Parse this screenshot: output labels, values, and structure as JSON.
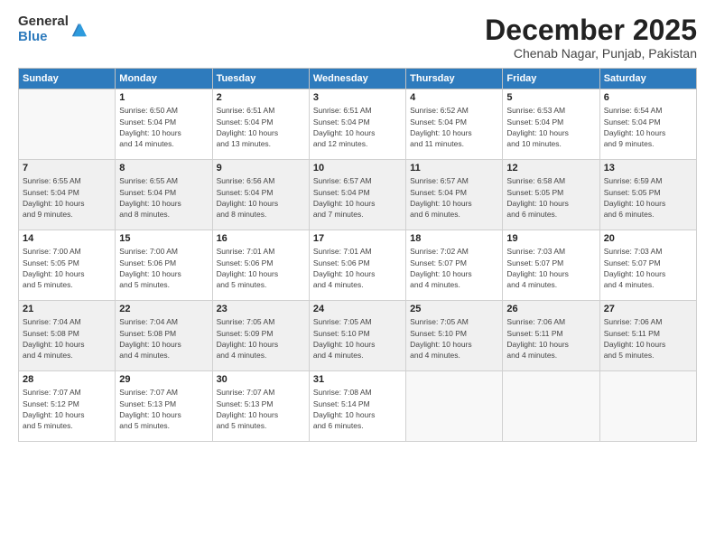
{
  "header": {
    "logo_general": "General",
    "logo_blue": "Blue",
    "month_title": "December 2025",
    "subtitle": "Chenab Nagar, Punjab, Pakistan"
  },
  "days_of_week": [
    "Sunday",
    "Monday",
    "Tuesday",
    "Wednesday",
    "Thursday",
    "Friday",
    "Saturday"
  ],
  "weeks": [
    [
      {
        "num": "",
        "info": ""
      },
      {
        "num": "1",
        "info": "Sunrise: 6:50 AM\nSunset: 5:04 PM\nDaylight: 10 hours\nand 14 minutes."
      },
      {
        "num": "2",
        "info": "Sunrise: 6:51 AM\nSunset: 5:04 PM\nDaylight: 10 hours\nand 13 minutes."
      },
      {
        "num": "3",
        "info": "Sunrise: 6:51 AM\nSunset: 5:04 PM\nDaylight: 10 hours\nand 12 minutes."
      },
      {
        "num": "4",
        "info": "Sunrise: 6:52 AM\nSunset: 5:04 PM\nDaylight: 10 hours\nand 11 minutes."
      },
      {
        "num": "5",
        "info": "Sunrise: 6:53 AM\nSunset: 5:04 PM\nDaylight: 10 hours\nand 10 minutes."
      },
      {
        "num": "6",
        "info": "Sunrise: 6:54 AM\nSunset: 5:04 PM\nDaylight: 10 hours\nand 9 minutes."
      }
    ],
    [
      {
        "num": "7",
        "info": "Sunrise: 6:55 AM\nSunset: 5:04 PM\nDaylight: 10 hours\nand 9 minutes."
      },
      {
        "num": "8",
        "info": "Sunrise: 6:55 AM\nSunset: 5:04 PM\nDaylight: 10 hours\nand 8 minutes."
      },
      {
        "num": "9",
        "info": "Sunrise: 6:56 AM\nSunset: 5:04 PM\nDaylight: 10 hours\nand 8 minutes."
      },
      {
        "num": "10",
        "info": "Sunrise: 6:57 AM\nSunset: 5:04 PM\nDaylight: 10 hours\nand 7 minutes."
      },
      {
        "num": "11",
        "info": "Sunrise: 6:57 AM\nSunset: 5:04 PM\nDaylight: 10 hours\nand 6 minutes."
      },
      {
        "num": "12",
        "info": "Sunrise: 6:58 AM\nSunset: 5:05 PM\nDaylight: 10 hours\nand 6 minutes."
      },
      {
        "num": "13",
        "info": "Sunrise: 6:59 AM\nSunset: 5:05 PM\nDaylight: 10 hours\nand 6 minutes."
      }
    ],
    [
      {
        "num": "14",
        "info": "Sunrise: 7:00 AM\nSunset: 5:05 PM\nDaylight: 10 hours\nand 5 minutes."
      },
      {
        "num": "15",
        "info": "Sunrise: 7:00 AM\nSunset: 5:06 PM\nDaylight: 10 hours\nand 5 minutes."
      },
      {
        "num": "16",
        "info": "Sunrise: 7:01 AM\nSunset: 5:06 PM\nDaylight: 10 hours\nand 5 minutes."
      },
      {
        "num": "17",
        "info": "Sunrise: 7:01 AM\nSunset: 5:06 PM\nDaylight: 10 hours\nand 4 minutes."
      },
      {
        "num": "18",
        "info": "Sunrise: 7:02 AM\nSunset: 5:07 PM\nDaylight: 10 hours\nand 4 minutes."
      },
      {
        "num": "19",
        "info": "Sunrise: 7:03 AM\nSunset: 5:07 PM\nDaylight: 10 hours\nand 4 minutes."
      },
      {
        "num": "20",
        "info": "Sunrise: 7:03 AM\nSunset: 5:07 PM\nDaylight: 10 hours\nand 4 minutes."
      }
    ],
    [
      {
        "num": "21",
        "info": "Sunrise: 7:04 AM\nSunset: 5:08 PM\nDaylight: 10 hours\nand 4 minutes."
      },
      {
        "num": "22",
        "info": "Sunrise: 7:04 AM\nSunset: 5:08 PM\nDaylight: 10 hours\nand 4 minutes."
      },
      {
        "num": "23",
        "info": "Sunrise: 7:05 AM\nSunset: 5:09 PM\nDaylight: 10 hours\nand 4 minutes."
      },
      {
        "num": "24",
        "info": "Sunrise: 7:05 AM\nSunset: 5:10 PM\nDaylight: 10 hours\nand 4 minutes."
      },
      {
        "num": "25",
        "info": "Sunrise: 7:05 AM\nSunset: 5:10 PM\nDaylight: 10 hours\nand 4 minutes."
      },
      {
        "num": "26",
        "info": "Sunrise: 7:06 AM\nSunset: 5:11 PM\nDaylight: 10 hours\nand 4 minutes."
      },
      {
        "num": "27",
        "info": "Sunrise: 7:06 AM\nSunset: 5:11 PM\nDaylight: 10 hours\nand 5 minutes."
      }
    ],
    [
      {
        "num": "28",
        "info": "Sunrise: 7:07 AM\nSunset: 5:12 PM\nDaylight: 10 hours\nand 5 minutes."
      },
      {
        "num": "29",
        "info": "Sunrise: 7:07 AM\nSunset: 5:13 PM\nDaylight: 10 hours\nand 5 minutes."
      },
      {
        "num": "30",
        "info": "Sunrise: 7:07 AM\nSunset: 5:13 PM\nDaylight: 10 hours\nand 5 minutes."
      },
      {
        "num": "31",
        "info": "Sunrise: 7:08 AM\nSunset: 5:14 PM\nDaylight: 10 hours\nand 6 minutes."
      },
      {
        "num": "",
        "info": ""
      },
      {
        "num": "",
        "info": ""
      },
      {
        "num": "",
        "info": ""
      }
    ]
  ]
}
